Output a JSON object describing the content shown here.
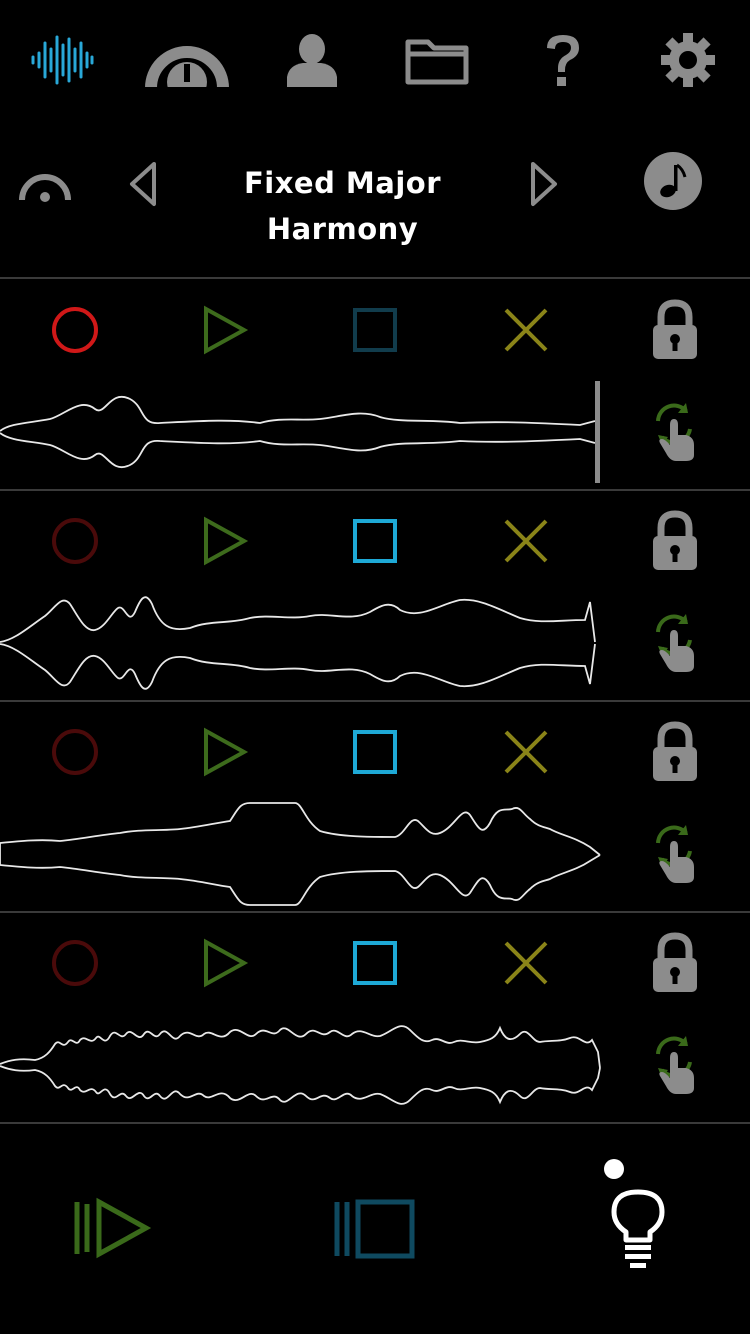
{
  "toolbar": {
    "items": [
      {
        "icon": "waveform-icon",
        "label": "audio"
      },
      {
        "icon": "gauge-icon",
        "label": "tempo"
      },
      {
        "icon": "user-icon",
        "label": "profile"
      },
      {
        "icon": "folder-icon",
        "label": "files"
      },
      {
        "icon": "help-icon",
        "label": "help"
      },
      {
        "icon": "gear-icon",
        "label": "settings"
      }
    ],
    "accent_color": "#29a8d8"
  },
  "preset": {
    "title": "Fixed Major Harmony",
    "prev_icon": "triangle-left-icon",
    "next_icon": "triangle-right-icon",
    "music_icon": "music-note-icon"
  },
  "tracks": [
    {
      "record_active": true,
      "stop_active": false
    },
    {
      "record_active": false,
      "stop_active": true
    },
    {
      "record_active": false,
      "stop_active": true
    },
    {
      "record_active": false,
      "stop_active": true
    }
  ],
  "colors": {
    "record_active": "#d01818",
    "record_inactive": "#4a0a0a",
    "play": "#3d6b1c",
    "stop_active": "#1ea9d6",
    "stop_inactive": "#113c4c",
    "clear": "#8a8418",
    "lock": "#8c8c8c",
    "bottom_play": "#3a6a1a",
    "bottom_stop": "#0f4a60"
  },
  "bottom": {
    "play_all_icon": "play-all-icon",
    "stop_all_icon": "stop-all-icon",
    "bulb_icon": "lightbulb-icon"
  }
}
